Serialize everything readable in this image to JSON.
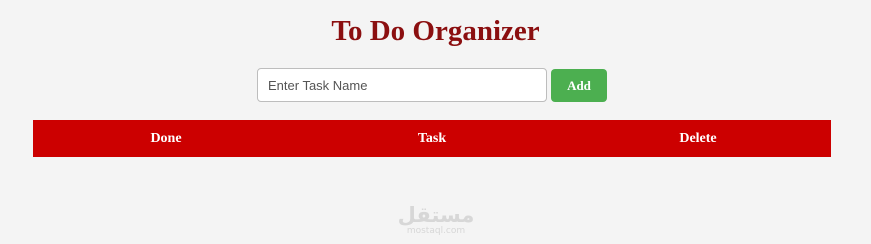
{
  "header": {
    "title": "To Do Organizer"
  },
  "form": {
    "task_input": {
      "value": "",
      "placeholder": "Enter Task Name"
    },
    "add_label": "Add"
  },
  "table": {
    "columns": [
      "Done",
      "Task",
      "Delete"
    ],
    "rows": []
  },
  "watermark": {
    "logo_text": "مستقل",
    "site": "mostaql.com"
  },
  "colors": {
    "title": "#8b0f10",
    "add_button": "#4caf50",
    "table_header": "#cc0000",
    "background": "#f4f4f4"
  }
}
